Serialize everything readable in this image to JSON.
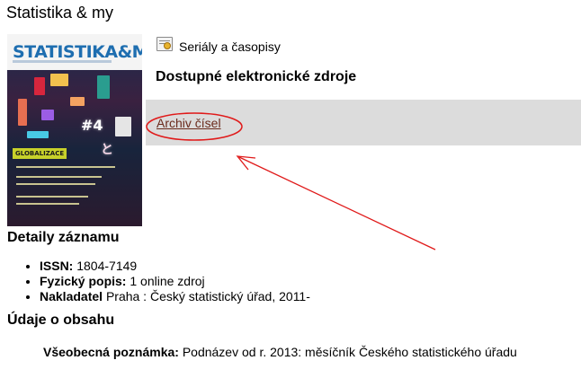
{
  "page": {
    "title": "Statistika & my"
  },
  "cover": {
    "masthead": "STATISTIKA&MY",
    "badge": "GLOBALIZACE",
    "colors": {
      "mast_text": "#1e6eb0",
      "badge_bg": "#c7d12a",
      "sky": "#1b2c4f"
    }
  },
  "serial": {
    "icon": "serial-icon",
    "label": "Seriály a časopisy"
  },
  "resources": {
    "heading": "Dostupné elektronické zdroje",
    "link_label": "Archiv čísel",
    "band_color": "#dcdcdc",
    "link_color": "#6a2a1c"
  },
  "details": {
    "heading": "Detaily záznamu",
    "items": [
      {
        "label": "ISSN:",
        "value": "1804-7149"
      },
      {
        "label": "Fyzický popis:",
        "value": "1 online zdroj"
      },
      {
        "label": "Nakladatel",
        "value": "Praha : Český statistický úřad, 2011-"
      }
    ]
  },
  "content": {
    "heading": "Údaje o obsahu",
    "note_label": "Všeobecná poznámka:",
    "note_value": "Podnázev od r. 2013: měsíčník Českého statistického úřadu"
  },
  "annotation": {
    "color": "#e01919"
  }
}
